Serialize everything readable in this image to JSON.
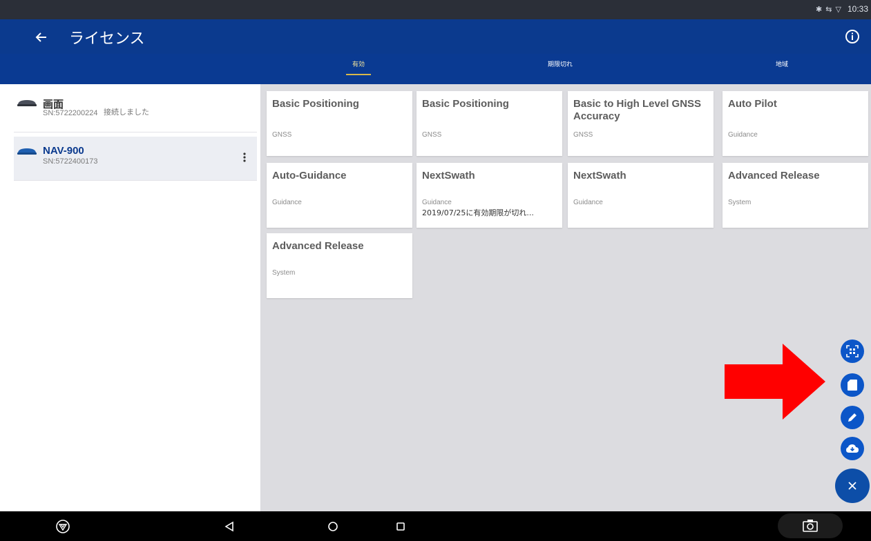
{
  "status_bar": {
    "icons": "✱ ⇆ ▽",
    "time": "10:33"
  },
  "app_bar": {
    "title": "ライセンス",
    "back_icon": "arrow-left-icon",
    "info_icon": "info-icon"
  },
  "tabs": [
    {
      "label": "有効",
      "active": true
    },
    {
      "label": "期限切れ",
      "active": false
    },
    {
      "label": "地域",
      "active": false
    }
  ],
  "devices": [
    {
      "name": "画面",
      "serial": "SN:5722200224",
      "status": "接続しました",
      "selected": false
    },
    {
      "name": "NAV-900",
      "serial": "SN:5722400173",
      "status": "",
      "selected": true
    }
  ],
  "licenses": [
    {
      "title": "Basic Positioning",
      "type": "GNSS",
      "expiry": ""
    },
    {
      "title": "Basic Positioning",
      "type": "GNSS",
      "expiry": ""
    },
    {
      "title": "Basic to High Level GNSS Accuracy",
      "type": "GNSS",
      "expiry": ""
    },
    {
      "title": "Auto Pilot",
      "type": "Guidance",
      "expiry": ""
    },
    {
      "title": "Auto-Guidance",
      "type": "Guidance",
      "expiry": ""
    },
    {
      "title": "NextSwath",
      "type": "Guidance",
      "expiry": "2019/07/25に有効期限が切れ..."
    },
    {
      "title": "NextSwath",
      "type": "Guidance",
      "expiry": ""
    },
    {
      "title": "Advanced Release",
      "type": "System",
      "expiry": ""
    },
    {
      "title": "Advanced Release",
      "type": "System",
      "expiry": ""
    }
  ],
  "fab": {
    "actions": [
      "qr-scan-icon",
      "sd-card-icon",
      "pencil-icon",
      "cloud-download-icon"
    ],
    "close_icon": "close-icon",
    "accent": "#0c56c8"
  },
  "annotation": {
    "color": "#ff0000",
    "icon": "red-arrow-icon"
  },
  "nav_bar": {
    "logo_icon": "trimble-logo-icon",
    "back_icon": "nav-back-icon",
    "home_icon": "nav-home-icon",
    "recents_icon": "nav-recents-icon",
    "screenshot_icon": "camera-icon"
  }
}
